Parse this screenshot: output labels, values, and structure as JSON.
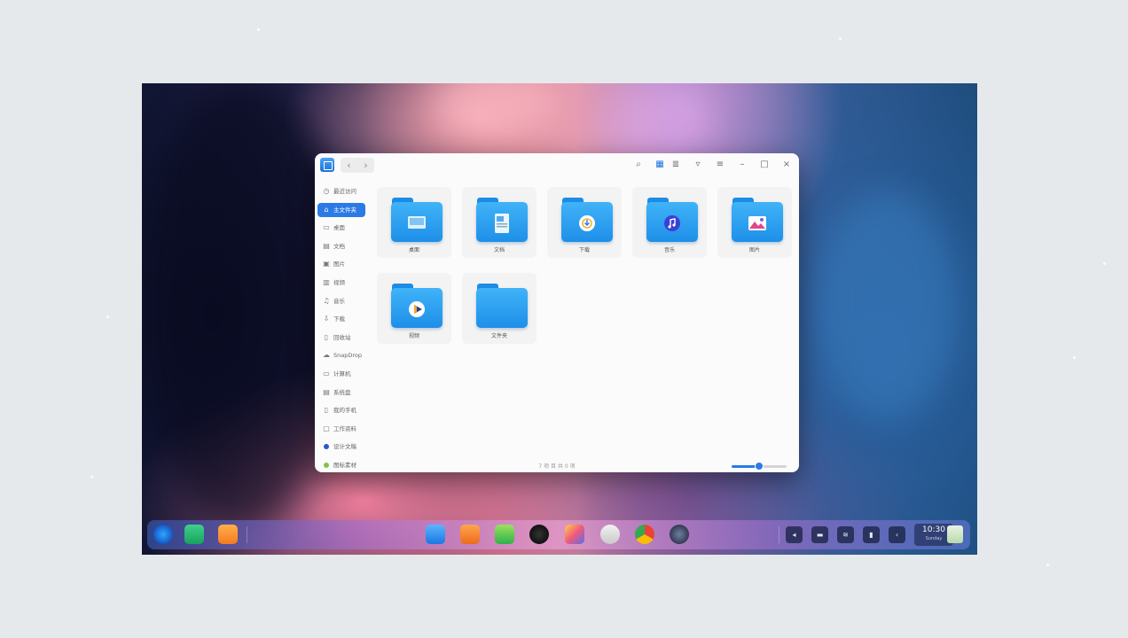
{
  "file_manager": {
    "nav": {
      "back": "‹",
      "forward": "›"
    },
    "toolbar": {
      "search_icon": "⌕",
      "icon_view_icon": "▦",
      "list_view_icon": "≣",
      "options_icon": "▿",
      "menu_icon": "≡",
      "minimize_icon": "–",
      "maximize_icon": "□",
      "close_icon": "×"
    },
    "sidebar": {
      "items": [
        {
          "label": "最近访问",
          "icon": "◷"
        },
        {
          "label": "主文件夹",
          "icon": "⌂",
          "active": true
        },
        {
          "label": "桌面",
          "icon": "▭"
        },
        {
          "label": "文档",
          "icon": "▤"
        },
        {
          "label": "图片",
          "icon": "▣"
        },
        {
          "label": "视频",
          "icon": "▥"
        },
        {
          "label": "音乐",
          "icon": "♫"
        },
        {
          "label": "下载",
          "icon": "⇩"
        },
        {
          "label": "回收站",
          "icon": "▯"
        },
        {
          "label": "SnapDrop",
          "icon": "☁"
        },
        {
          "label": "计算机",
          "icon": "▭"
        },
        {
          "label": "系统盘",
          "icon": "▤"
        },
        {
          "label": "我的手机",
          "icon": "▯"
        },
        {
          "label": "工作资料",
          "icon": "▢"
        },
        {
          "label": "设计文稿",
          "dot_color": "#2d57c8"
        },
        {
          "label": "图标素材",
          "dot_color": "#7cc64a"
        }
      ]
    },
    "folders": [
      {
        "label": "桌面",
        "icon": "desktop-folder-icon"
      },
      {
        "label": "文档",
        "icon": "documents-folder-icon"
      },
      {
        "label": "下载",
        "icon": "downloads-folder-icon"
      },
      {
        "label": "音乐",
        "icon": "music-folder-icon"
      },
      {
        "label": "图片",
        "icon": "pictures-folder-icon"
      },
      {
        "label": "视频",
        "icon": "videos-folder-icon"
      },
      {
        "label": "文件夹",
        "icon": "plain-folder-icon"
      }
    ],
    "status_text": "7 项 目 共 0 项",
    "zoom_level": 0.5
  },
  "dock": {
    "left_apps": [
      "launcher-icon",
      "multitask-view-icon",
      "calendar-icon"
    ],
    "center_apps": [
      "file-manager-icon",
      "app-store-icon",
      "music-icon",
      "movie-icon",
      "image-viewer-icon",
      "camera-icon",
      "chrome-icon",
      "control-center-icon"
    ],
    "tray": [
      {
        "name": "volume-icon",
        "glyph": "◂"
      },
      {
        "name": "keyboard-icon",
        "glyph": "▬"
      },
      {
        "name": "wifi-icon",
        "glyph": "≋"
      },
      {
        "name": "battery-icon",
        "glyph": "▮"
      },
      {
        "name": "expand-icon",
        "glyph": "‹"
      }
    ],
    "clock_time": "10:30",
    "clock_date": "Sunday"
  }
}
